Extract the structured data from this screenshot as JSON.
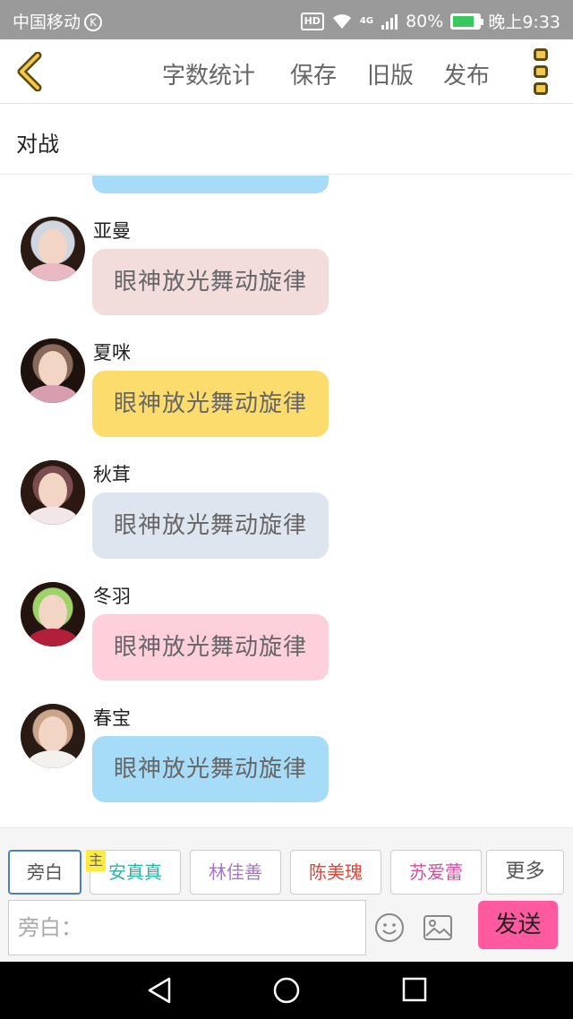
{
  "status_bar": {
    "carrier": "中国移动",
    "k_badge": "K",
    "hd": "HD",
    "network": "4G",
    "battery": "80%",
    "battery_level": 0.8,
    "time": "晚上9:33"
  },
  "nav": {
    "word_count": "字数统计",
    "save": "保存",
    "old_version": "旧版",
    "publish": "发布"
  },
  "title": "对战",
  "messages": [
    {
      "name": "亚曼",
      "text": "眼神放光舞动旋律",
      "bubble_color": "#f2dcdc"
    },
    {
      "name": "夏咪",
      "text": "眼神放光舞动旋律",
      "bubble_color": "#fcdc6c"
    },
    {
      "name": "秋茸",
      "text": "眼神放光舞动旋律",
      "bubble_color": "#dfe5ee"
    },
    {
      "name": "冬羽",
      "text": "眼神放光舞动旋律",
      "bubble_color": "#fdd0dc"
    },
    {
      "name": "春宝",
      "text": "眼神放光舞动旋律",
      "bubble_color": "#a6dcf7"
    }
  ],
  "characters": {
    "narration": "旁白",
    "main_badge": "主",
    "c1": "安真真",
    "c2": "林佳善",
    "c3": "陈美瑰",
    "c4": "苏爱蕾",
    "more": "更多"
  },
  "character_colors": {
    "c1": "#27b5a8",
    "c2": "#a874c9",
    "c3": "#d9473a",
    "c4": "#d14ea1"
  },
  "input": {
    "placeholder": "旁白："
  },
  "send_label": "发送",
  "colors": {
    "accent_yellow": "#f2c94c",
    "send_pink": "#ff5aa0"
  }
}
